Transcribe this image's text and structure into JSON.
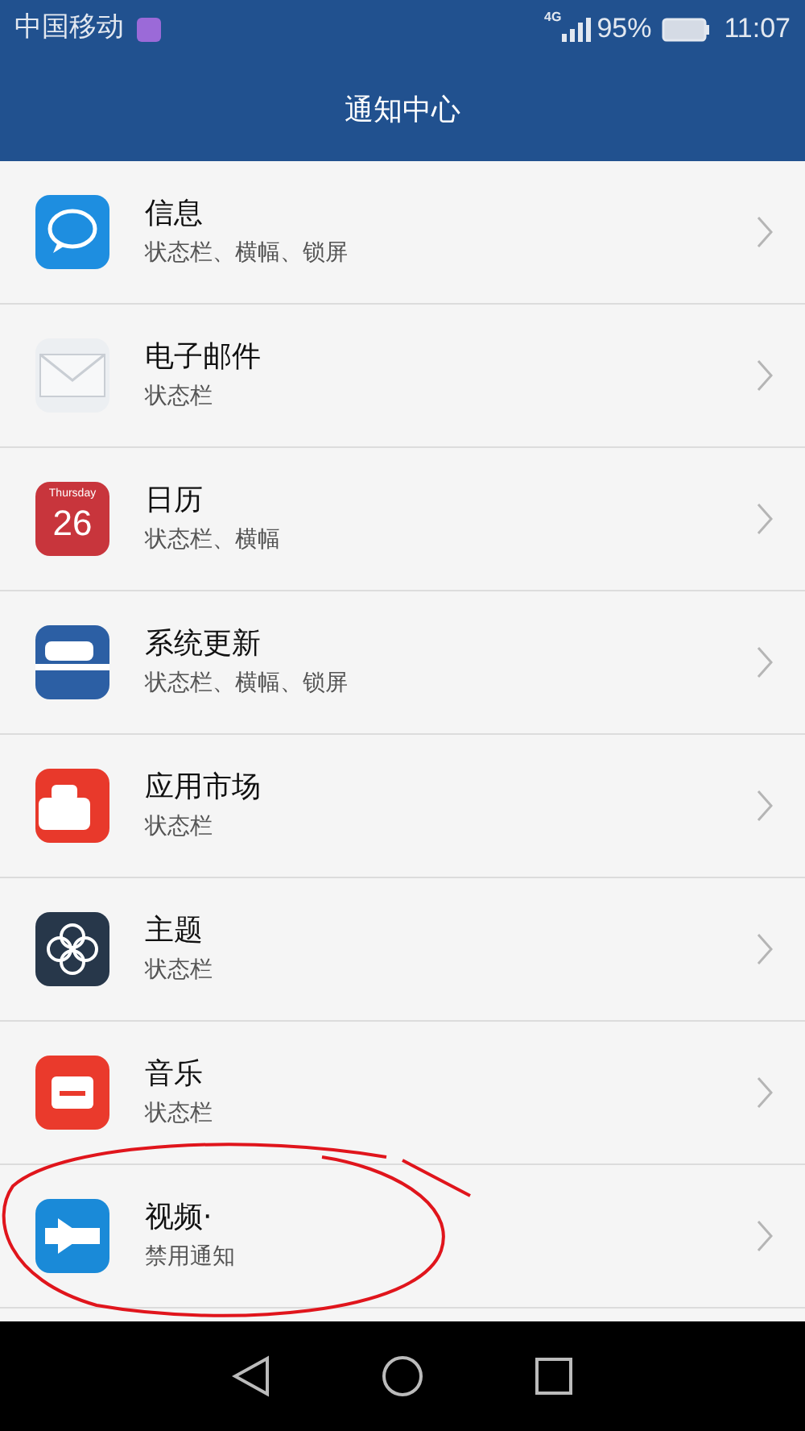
{
  "status_bar": {
    "carrier": "中国移动",
    "network": "4G",
    "battery": "95%",
    "time": "11:07"
  },
  "header": {
    "title": "通知中心"
  },
  "apps": [
    {
      "kind": "message",
      "name": "信息",
      "detail": "状态栏、横幅、锁屏"
    },
    {
      "kind": "mail",
      "name": "电子邮件",
      "detail": "状态栏"
    },
    {
      "kind": "calendar",
      "name": "日历",
      "detail": "状态栏、横幅",
      "icon_day": "Thursday",
      "icon_date": "26"
    },
    {
      "kind": "update",
      "name": "系统更新",
      "detail": "状态栏、横幅、锁屏"
    },
    {
      "kind": "store",
      "name": "应用市场",
      "detail": "状态栏"
    },
    {
      "kind": "theme",
      "name": "主题",
      "detail": "状态栏"
    },
    {
      "kind": "music",
      "name": "音乐",
      "detail": "状态栏"
    },
    {
      "kind": "video",
      "name": "视频·",
      "detail": "禁用通知"
    }
  ]
}
